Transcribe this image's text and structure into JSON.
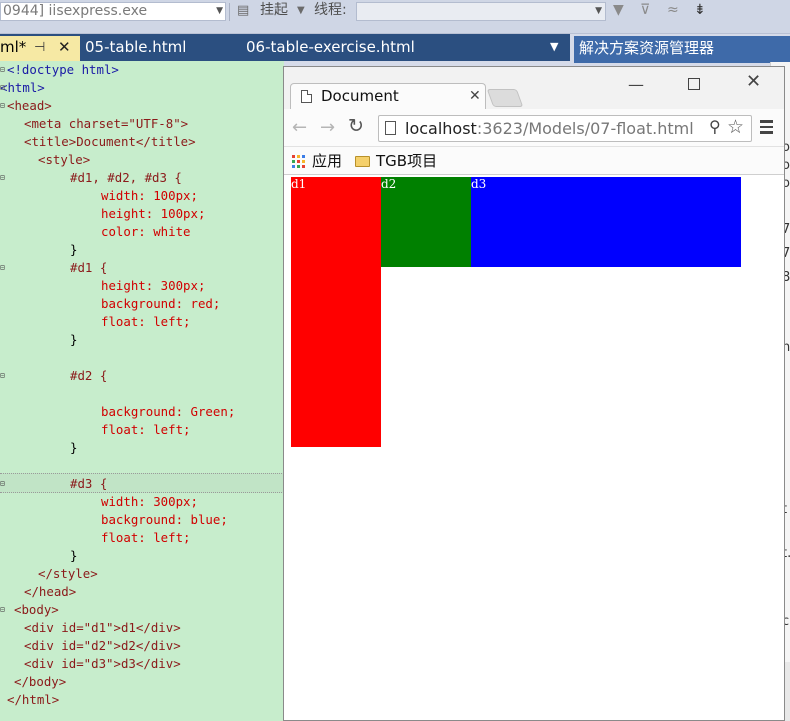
{
  "toolbar": {
    "process": "0944] iisexpress.exe",
    "suspend": "挂起",
    "thread": "线程:"
  },
  "doc_tabs": [
    {
      "label": "ml*",
      "active": true
    },
    {
      "label": "05-table.html",
      "active": false
    },
    {
      "label": "06-table-exercise.html",
      "active": false
    }
  ],
  "solution_explorer": {
    "title": "解决方案资源管理器"
  },
  "right_panel_glyphs": [
    "o",
    "o",
    "o",
    "7",
    "7",
    "8",
    "n",
    "t",
    "t.",
    "c"
  ],
  "code_lines": [
    "<!doctype html>",
    "<html>",
    "<head>",
    "<meta charset=\"UTF-8\">",
    "<title>Document</title>",
    "<style>",
    "#d1, #d2, #d3 {",
    "width: 100px;",
    "height: 100px;",
    "color: white",
    "}",
    "#d1 {",
    "height: 300px;",
    "background: red;",
    "float: left;",
    "}",
    "",
    "#d2 {",
    "",
    "background: Green;",
    "float: left;",
    "}",
    "",
    "#d3 {",
    "width: 300px;",
    "background: blue;",
    "float: left;",
    "}",
    "</style>",
    "</head>",
    "<body>",
    "<div id=\"d1\">d1</div>",
    "<div id=\"d2\">d2</div>",
    "<div id=\"d3\">d3</div>",
    "</body>",
    "</html>"
  ],
  "browser": {
    "tab_title": "Document",
    "url_host": "localhost",
    "url_rest": ":3623/Models/07-float.html",
    "bookmarks": [
      "应用",
      "TGB项目"
    ]
  },
  "page_boxes": [
    {
      "label": "d1",
      "color": "#ff0000"
    },
    {
      "label": "d2",
      "color": "#008000"
    },
    {
      "label": "d3",
      "color": "#0000ff"
    }
  ],
  "colors": {
    "editor_bg": "#c7edcc",
    "tab_bar": "#2b4f80",
    "active_tab": "#f6e9a4",
    "solution_header": "#3e6aa9"
  }
}
